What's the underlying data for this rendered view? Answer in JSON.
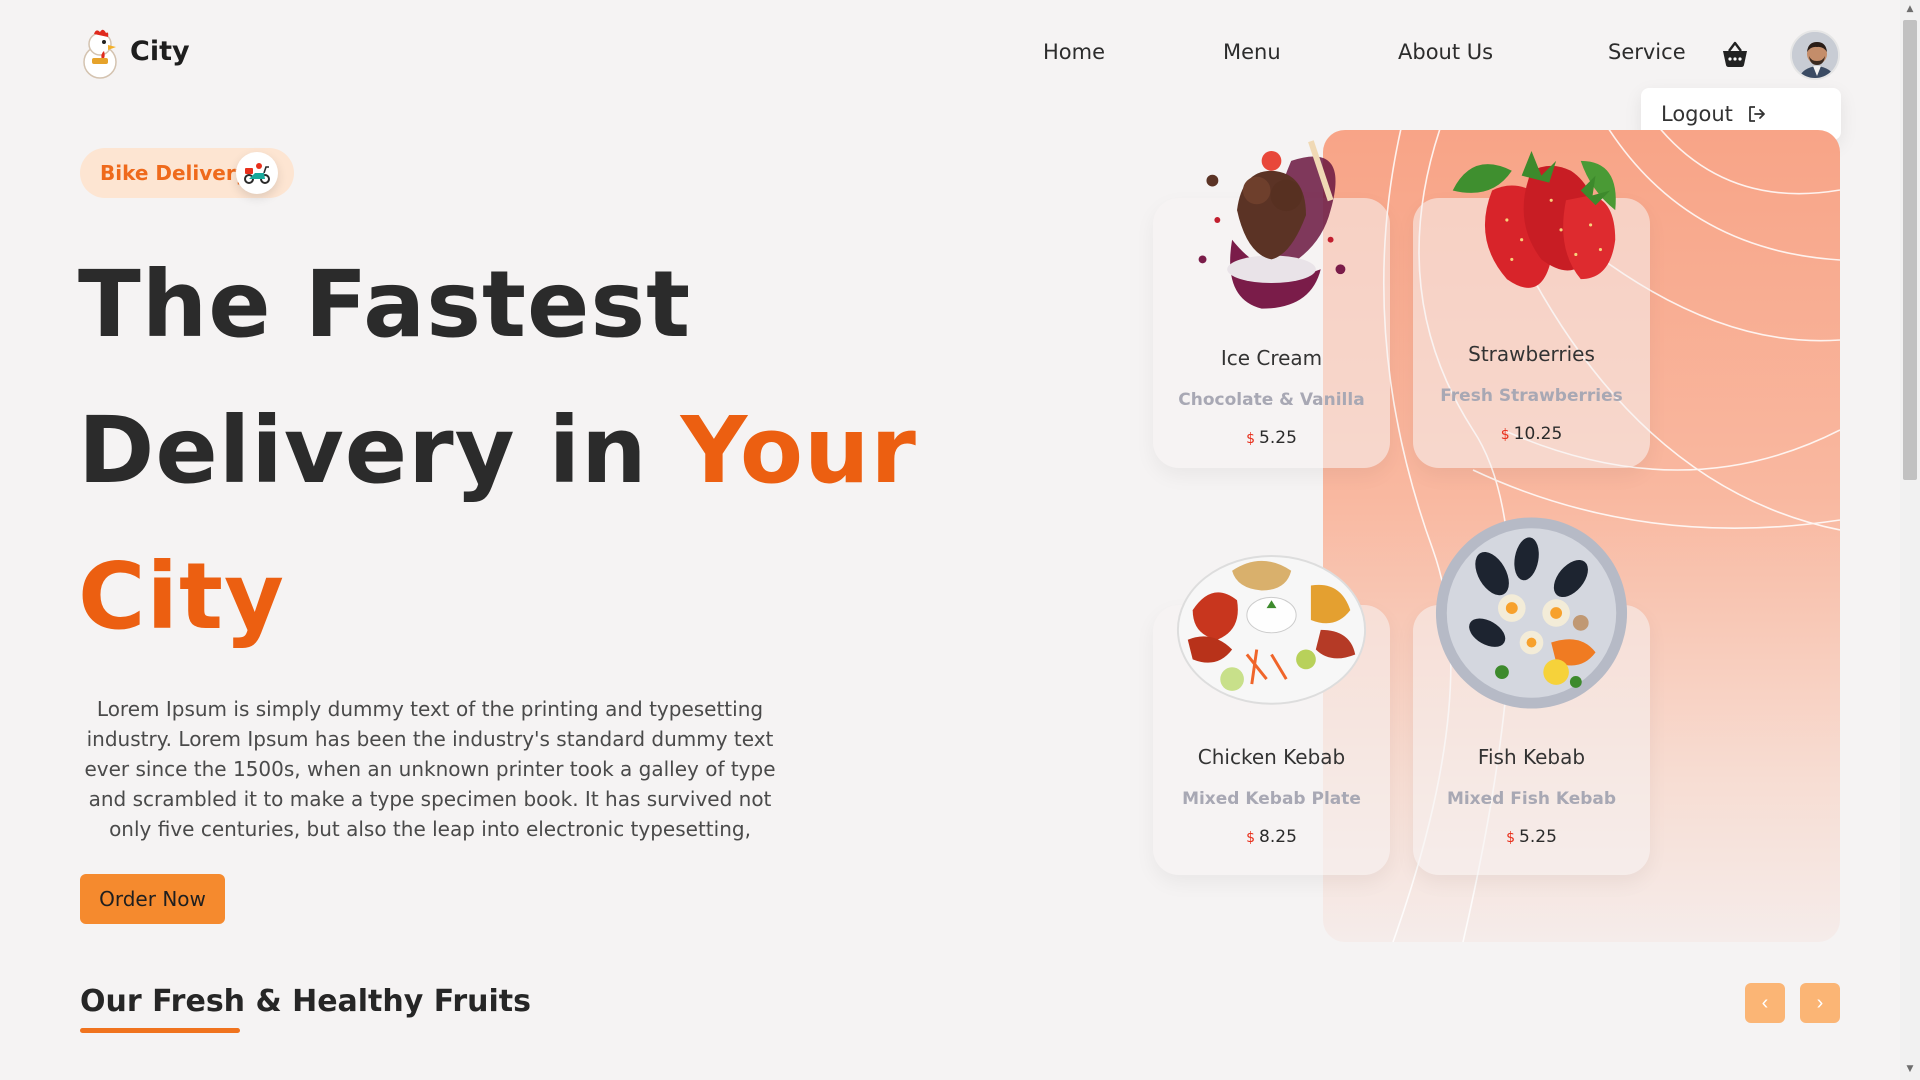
{
  "header": {
    "logo_text": "City",
    "nav": [
      "Home",
      "Menu",
      "About Us",
      "Service"
    ],
    "dropdown_label": "Logout"
  },
  "hero": {
    "badge": "Bike Delivery",
    "headline_line1": "The Fastest",
    "headline_line2_a": "Delivery in",
    "headline_line2_b": "Your",
    "headline_line3": "City",
    "description": "Lorem Ipsum is simply dummy text of the printing and typesetting industry. Lorem Ipsum has been the industry's standard dummy text ever since the 1500s, when an unknown printer took a galley of type and scrambled it to make a type specimen book. It has survived not only five centuries, but also the leap into electronic typesetting,",
    "order_button": "Order Now"
  },
  "cards": [
    {
      "name": "Ice Cream",
      "sub": "Chocolate & Vanilla",
      "currency": "$",
      "price": "5.25",
      "icon": "ice-cream-icon"
    },
    {
      "name": "Strawberries",
      "sub": "Fresh Strawberries",
      "currency": "$",
      "price": "10.25",
      "icon": "strawberry-icon"
    },
    {
      "name": "Chicken Kebab",
      "sub": "Mixed Kebab Plate",
      "currency": "$",
      "price": "8.25",
      "icon": "kebab-plate-icon"
    },
    {
      "name": "Fish Kebab",
      "sub": "Mixed Fish Kebab",
      "currency": "$",
      "price": "5.25",
      "icon": "seafood-plate-icon"
    }
  ],
  "section": {
    "title": "Our Fresh & Healthy Fruits",
    "prev_label": "‹",
    "next_label": "›"
  },
  "colors": {
    "accent": "#ec5f11",
    "button": "#f58a2e",
    "badge_bg": "#fde5d2",
    "panel_top": "#f8a487"
  }
}
